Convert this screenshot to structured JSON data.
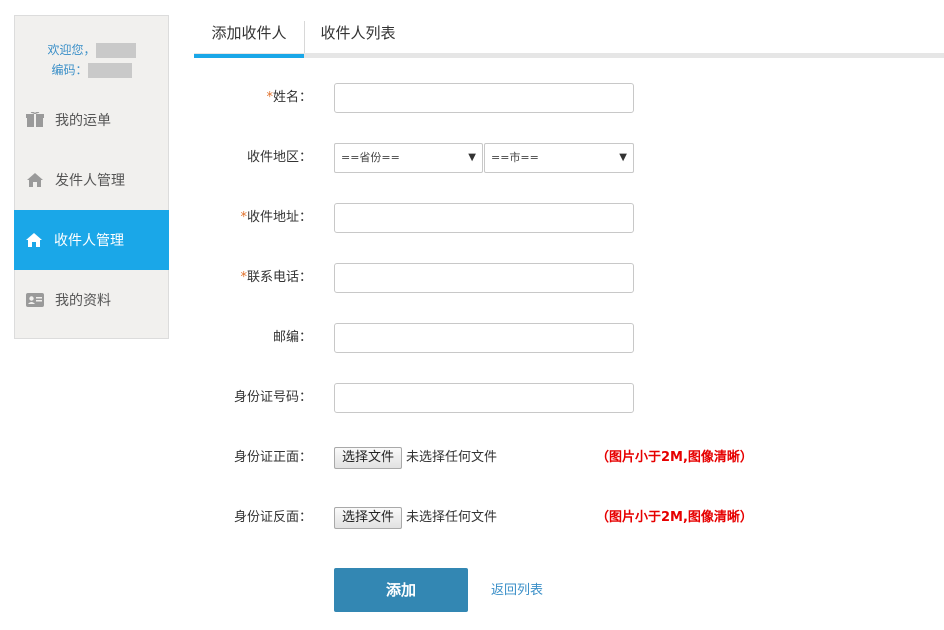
{
  "sidebar": {
    "welcome_label": "欢迎您，",
    "code_label": "编码：",
    "items": [
      {
        "label": "我的运单",
        "icon": "gift-box-icon"
      },
      {
        "label": "发件人管理",
        "icon": "home-icon"
      },
      {
        "label": "收件人管理",
        "icon": "home-icon"
      },
      {
        "label": "我的资料",
        "icon": "id-card-icon"
      }
    ],
    "active_index": 2
  },
  "tabs": [
    {
      "label": "添加收件人",
      "active": true
    },
    {
      "label": "收件人列表",
      "active": false
    }
  ],
  "form": {
    "required_mark": "*",
    "name_label": "姓名：",
    "region_label": "收件地区：",
    "province_select": "==省份==",
    "city_select": "==市==",
    "address_label": "收件地址：",
    "phone_label": "联系电话：",
    "postcode_label": "邮编：",
    "idnumber_label": "身份证号码：",
    "idfront_label": "身份证正面：",
    "idback_label": "身份证反面：",
    "choose_file_button": "选择文件",
    "no_file_text": "未选择任何文件",
    "image_hint": "（图片小于2M,图像清晰）",
    "submit_button": "添加",
    "back_link": "返回列表"
  },
  "colors": {
    "accent": "#1aa7e8",
    "submit": "#3387b3",
    "link": "#3a8fc8",
    "required": "#e0702a",
    "hint": "#e60000"
  }
}
